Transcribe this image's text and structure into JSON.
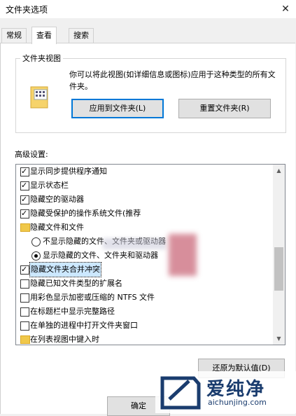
{
  "window": {
    "title": "文件夹选项",
    "close_glyph": "✕"
  },
  "tabs": [
    {
      "label": "常规"
    },
    {
      "label": "查看"
    },
    {
      "label": "搜索"
    }
  ],
  "folder_views": {
    "legend": "文件夹视图",
    "description": "你可以将此视图(如详细信息或图标)应用于这种类型的所有文件夹。",
    "apply_button": "应用到文件夹(L)",
    "reset_button": "重置文件夹(R)"
  },
  "advanced": {
    "label": "高级设置:",
    "items": [
      {
        "type": "checkbox",
        "checked": true,
        "label": "显示同步提供程序通知"
      },
      {
        "type": "checkbox",
        "checked": true,
        "label": "显示状态栏"
      },
      {
        "type": "checkbox",
        "checked": true,
        "label": "隐藏空的驱动器"
      },
      {
        "type": "checkbox",
        "checked": true,
        "label": "隐藏受保护的操作系统文件(推荐"
      },
      {
        "type": "folder",
        "label": "隐藏文件和文件"
      },
      {
        "type": "radio",
        "checked": false,
        "label": "不显示隐藏的文件、文件夹或驱动器"
      },
      {
        "type": "radio",
        "checked": true,
        "label": "显示隐藏的文件、文件夹和驱动器"
      },
      {
        "type": "checkbox",
        "checked": true,
        "label": "隐藏文件夹合并冲突",
        "selected": true
      },
      {
        "type": "checkbox",
        "checked": false,
        "label": "隐藏已知文件类型的扩展名"
      },
      {
        "type": "checkbox",
        "checked": false,
        "label": "用彩色显示加密或压缩的 NTFS 文件"
      },
      {
        "type": "checkbox",
        "checked": false,
        "label": "在标题栏中显示完整路径"
      },
      {
        "type": "checkbox",
        "checked": false,
        "label": "在单独的进程中打开文件夹窗口"
      },
      {
        "type": "folder",
        "label": "在列表视图中键入时"
      }
    ],
    "restore_button": "还原为默认值(D)"
  },
  "footer": {
    "ok_button": "确定"
  },
  "watermark": {
    "brand": "爱纯净",
    "url": "aichunjing.com"
  },
  "colors": {
    "selection": "#cce8ff",
    "focus": "#0078d7",
    "watermark": "#1a3c6e"
  }
}
